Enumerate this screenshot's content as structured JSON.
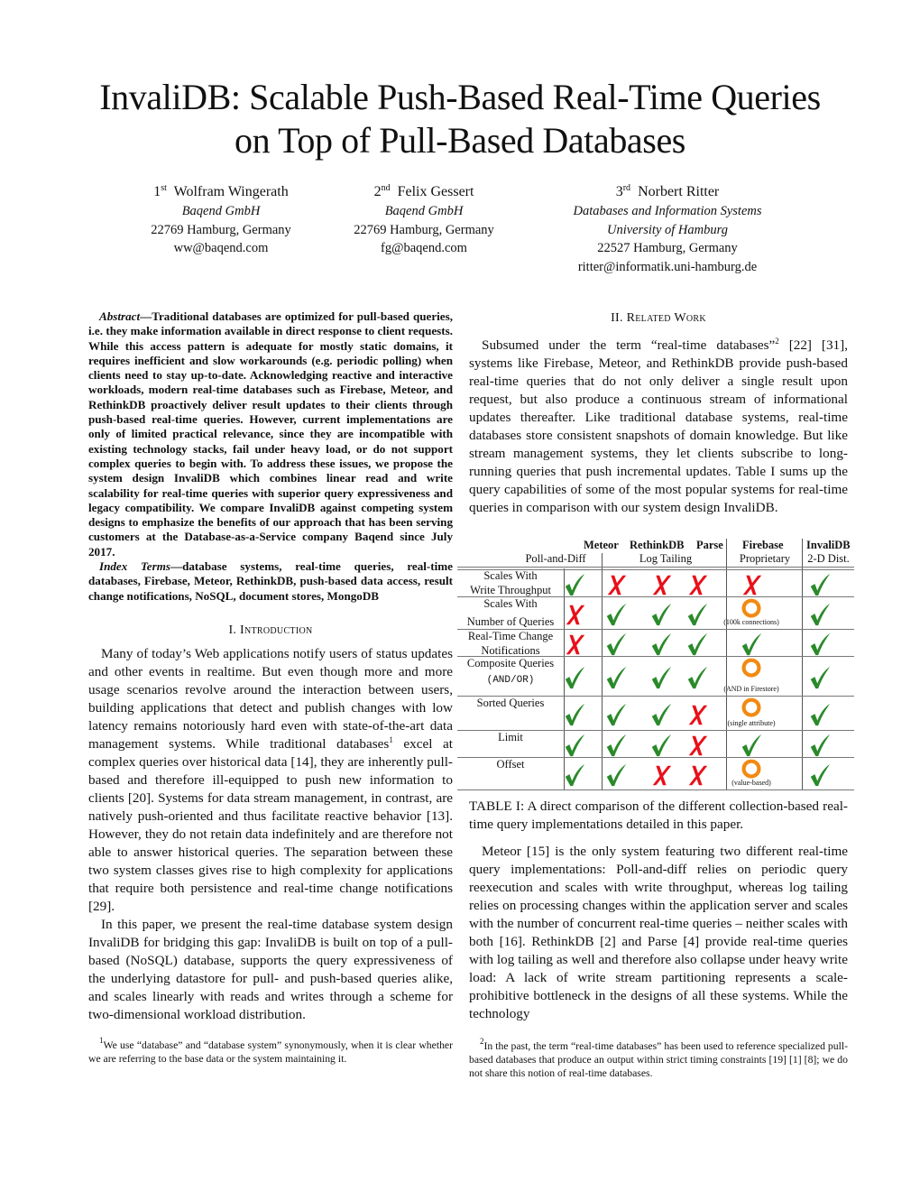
{
  "paper": {
    "title_line1": "InvaliDB: Scalable Push-Based Real-Time Queries",
    "title_line2": "on Top of Pull-Based Databases"
  },
  "authors": [
    {
      "ordinal": "1",
      "ordinal_suffix": "st",
      "name": "Wolfram Wingerath",
      "lines": [
        "Baqend GmbH",
        "22769 Hamburg, Germany",
        "ww@baqend.com"
      ],
      "italic_lines": 1
    },
    {
      "ordinal": "2",
      "ordinal_suffix": "nd",
      "name": "Felix Gessert",
      "lines": [
        "Baqend GmbH",
        "22769 Hamburg, Germany",
        "fg@baqend.com"
      ],
      "italic_lines": 1
    },
    {
      "ordinal": "3",
      "ordinal_suffix": "rd",
      "name": "Norbert Ritter",
      "lines": [
        "Databases and Information Systems",
        "University of Hamburg",
        "22527 Hamburg, Germany",
        "ritter@informatik.uni-hamburg.de"
      ],
      "italic_lines": 2
    }
  ],
  "abstract": {
    "label": "Abstract",
    "text": "—Traditional databases are optimized for pull-based queries, i.e. they make information available in direct response to client requests. While this access pattern is adequate for mostly static domains, it requires inefficient and slow workarounds (e.g. periodic polling) when clients need to stay up-to-date. Acknowledging reactive and interactive workloads, modern real-time databases such as Firebase, Meteor, and RethinkDB proactively deliver result updates to their clients through push-based real-time queries. However, current implementations are only of limited practical relevance, since they are incompatible with existing technology stacks, fail under heavy load, or do not support complex queries to begin with. To address these issues, we propose the system design InvaliDB which combines linear read and write scalability for real-time queries with superior query expressiveness and legacy compatibility. We compare InvaliDB against competing system designs to emphasize the benefits of our approach that has been serving customers at the Database-as-a-Service company Baqend since July 2017."
  },
  "index_terms": {
    "label": "Index Terms",
    "text": "—database systems, real-time queries, real-time databases, Firebase, Meteor, RethinkDB, push-based data access, result change notifications, NoSQL, document stores, MongoDB"
  },
  "sections": {
    "intro": {
      "heading": "I. Introduction",
      "p1_a": "Many of today’s Web applications notify users of status updates and other events in realtime. But even though more and more usage scenarios revolve around the interaction between users, building applications that detect and publish changes with low latency remains notoriously hard even with state-of-the-art data management systems. While traditional databases",
      "p1_fn": "1",
      "p1_b": " excel at complex queries over historical data [14], they are inherently pull-based and therefore ill-equipped to push new information to clients [20]. Systems for data stream management, in contrast, are natively push-oriented and thus facilitate reactive behavior [13]. However, they do not retain data indefinitely and are therefore not able to answer historical queries. The separation between these two system classes gives rise to high complexity for applications that require both persistence and real-time change notifications [29].",
      "p2": "In this paper, we present the real-time database system design InvaliDB for bridging this gap: InvaliDB is built on top of a pull-based (NoSQL) database, supports the query expressiveness of the underlying datastore for pull- and push-based queries alike, and scales linearly with reads and writes through a scheme for two-dimensional workload distribution."
    },
    "related": {
      "heading": "II. Related Work",
      "p1_a": "Subsumed under the term “real-time databases”",
      "p1_fn": "2",
      "p1_b": " [22] [31], systems like Firebase, Meteor, and RethinkDB provide push-based real-time queries that do not only deliver a single result upon request, but also produce a continuous stream of informational updates thereafter. Like traditional database systems, real-time databases store consistent snapshots of domain knowledge. But like stream management systems, they let clients subscribe to long-running queries that push incremental updates. Table I sums up the query capabilities of some of the most popular systems for real-time queries in comparison with our system design InvaliDB.",
      "p2": "Meteor [15] is the only system featuring two different real-time query implementations: Poll-and-diff relies on periodic query reexecution and scales with write throughput, whereas log tailing relies on processing changes within the application server and scales with the number of concurrent real-time queries – neither scales with both [16]. RethinkDB [2] and Parse [4] provide real-time queries with log tailing as well and therefore also collapse under heavy write load: A lack of write stream partitioning represents a scale-prohibitive bottleneck in the designs of all these systems. While the technology"
    }
  },
  "footnotes": [
    {
      "num": "1",
      "text": "We use “database” and “database system” synonymously, when it is clear whether we are referring to the base data or the system maintaining it."
    },
    {
      "num": "2",
      "text": "In the past, the term “real-time databases” has been used to reference specialized pull-based databases that produce an output within strict timing constraints [19] [1] [8]; we do not share this notion of real-time databases."
    }
  ],
  "table": {
    "caption": "TABLE I: A direct comparison of the different collection-based real-time query implementations detailed in this paper.",
    "systems": [
      "Meteor",
      "RethinkDB",
      "Parse",
      "Firebase",
      "InvaliDB"
    ],
    "groups": [
      "Poll-and-Diff",
      "Log Tailing",
      "Proprietary",
      "2-D Dist."
    ],
    "columns": [
      "Meteor (Poll-and-Diff)",
      "Meteor (Log Tailing)",
      "RethinkDB",
      "Parse",
      "Firebase",
      "InvaliDB"
    ],
    "rows": [
      {
        "label1": "Scales With",
        "label2": "Write Throughput",
        "values": [
          "yes",
          "no",
          "no",
          "no",
          "no",
          "yes"
        ],
        "firebase_note": ""
      },
      {
        "label1": "Scales With",
        "label2": "Number of Queries",
        "values": [
          "no",
          "yes",
          "yes",
          "yes",
          "partial",
          "yes"
        ],
        "firebase_note": "(100k connections)"
      },
      {
        "label1": "Real-Time Change",
        "label2": "Notifications",
        "values": [
          "no",
          "yes",
          "yes",
          "yes",
          "yes",
          "yes"
        ],
        "firebase_note": ""
      },
      {
        "label1": "Composite Queries",
        "label2": "(AND/OR)",
        "values": [
          "yes",
          "yes",
          "yes",
          "yes",
          "partial",
          "yes"
        ],
        "firebase_note": "(AND in Firestore)"
      },
      {
        "label1": "Sorted Queries",
        "label2": "",
        "values": [
          "yes",
          "yes",
          "yes",
          "no",
          "partial",
          "yes"
        ],
        "firebase_note": "(single attribute)"
      },
      {
        "label1": "Limit",
        "label2": "",
        "values": [
          "yes",
          "yes",
          "yes",
          "no",
          "yes",
          "yes"
        ],
        "firebase_note": ""
      },
      {
        "label1": "Offset",
        "label2": "",
        "values": [
          "yes",
          "yes",
          "no",
          "no",
          "partial",
          "yes"
        ],
        "firebase_note": "(value-based)"
      }
    ],
    "legend_icons": {
      "yes": "check-icon",
      "no": "cross-icon",
      "partial": "circle-icon"
    },
    "colors": {
      "yes": "#2a8a2a",
      "no": "#e8101a",
      "partial": "#f28a12"
    }
  }
}
